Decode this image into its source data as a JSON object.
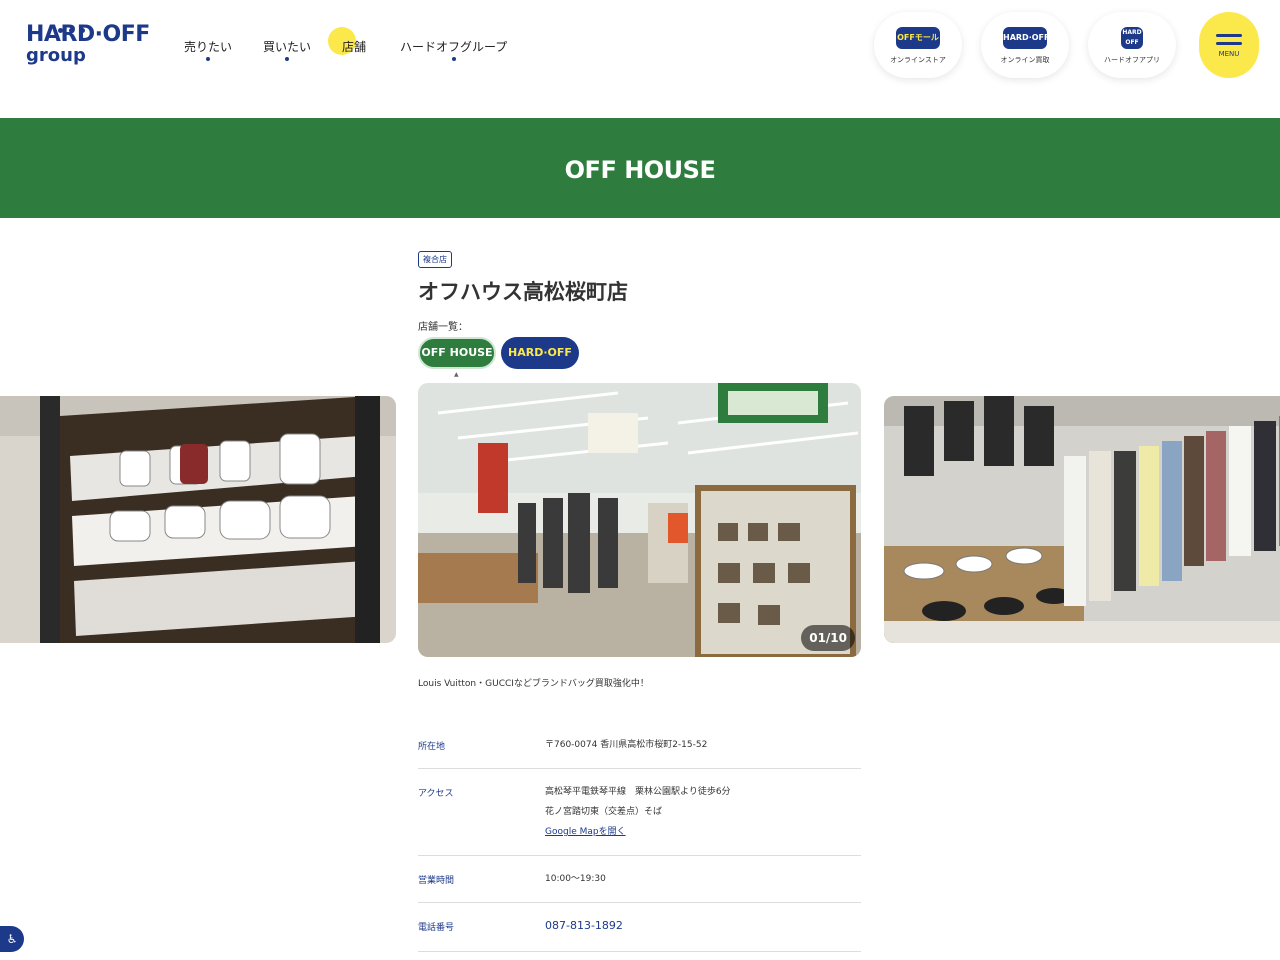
{
  "header": {
    "logo_top": "HARD·OFF",
    "logo_bottom": "group",
    "nav": [
      {
        "label": "売りたい"
      },
      {
        "label": "買いたい"
      },
      {
        "label": "店舗"
      },
      {
        "label": "ハードオフグループ"
      }
    ],
    "quick_links": [
      {
        "icon_text": "OFFモール",
        "label": "オンラインストア"
      },
      {
        "icon_text": "HARD·OFF",
        "label": "オンライン買取"
      },
      {
        "icon_text": "HARD OFF",
        "label": "ハードオフアプリ"
      }
    ],
    "menu_label": "MENU"
  },
  "banner": {
    "brand": "OFF HOUSE"
  },
  "store": {
    "badge": "複合店",
    "title": "オフハウス高松桜町店",
    "list_label": "店舗一覧：",
    "brands": [
      {
        "label": "OFF HOUSE"
      },
      {
        "label": "HARD·OFF"
      }
    ]
  },
  "gallery": {
    "counter": "01/10",
    "caption": "Louis Vuitton・GUCCIなどブランドバッグ買取強化中！"
  },
  "info": {
    "address_label": "所在地",
    "address_value": "〒760-0074 香川県高松市桜町2-15-52",
    "access_label": "アクセス",
    "access_line1": "高松琴平電鉄琴平線　栗林公園駅より徒歩6分",
    "access_line2": "花ノ宮踏切東（交差点）そば",
    "access_map_link": "Google Mapを開く",
    "hours_label": "営業時間",
    "hours_value": "10:00〜19:30",
    "phone_label": "電話番号",
    "phone_value": "087-813-1892"
  },
  "colors": {
    "brand_navy": "#1d3a8a",
    "brand_yellow": "#fbe84a",
    "offhouse_green": "#2e7d3e"
  }
}
